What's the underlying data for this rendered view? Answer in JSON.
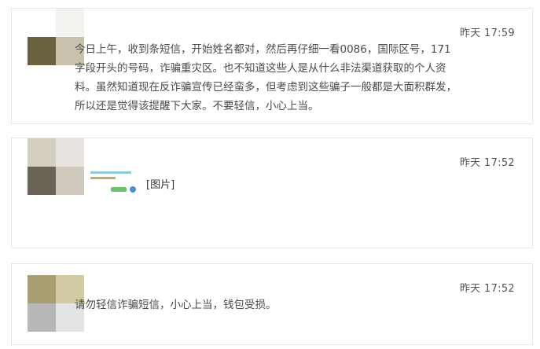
{
  "posts": [
    {
      "time": "昨天 17:59",
      "text": "今日上午，收到条短信，开始姓名都对，然后再仔细一看0086，国际区号，171字段开头的号码，诈骗重灾区。也不知道这些人是从什么非法渠道获取的个人资料。虽然知道现在反诈骗宣传已经蛮多，但考虑到这些骗子一般都是大面积群发，所以还是觉得该提醒下大家。不要轻信，小心上当。"
    },
    {
      "time": "昨天 17:52",
      "image_label": "[图片]"
    },
    {
      "time": "昨天 17:52",
      "text": "请勿轻信诈骗短信，小心上当，钱包受损。"
    }
  ],
  "colors": {
    "avatar1": [
      "#6b6240",
      "#c9c3ad",
      "#8a826a",
      "#dcd8cc"
    ],
    "avatar2": [
      "#d5cfc2",
      "#e7e4df",
      "#6a6556",
      "#cfcabd"
    ],
    "avatar3": [
      "#a89e72",
      "#d3cba4",
      "#b7b7b7",
      "#e3e3e3"
    ]
  }
}
